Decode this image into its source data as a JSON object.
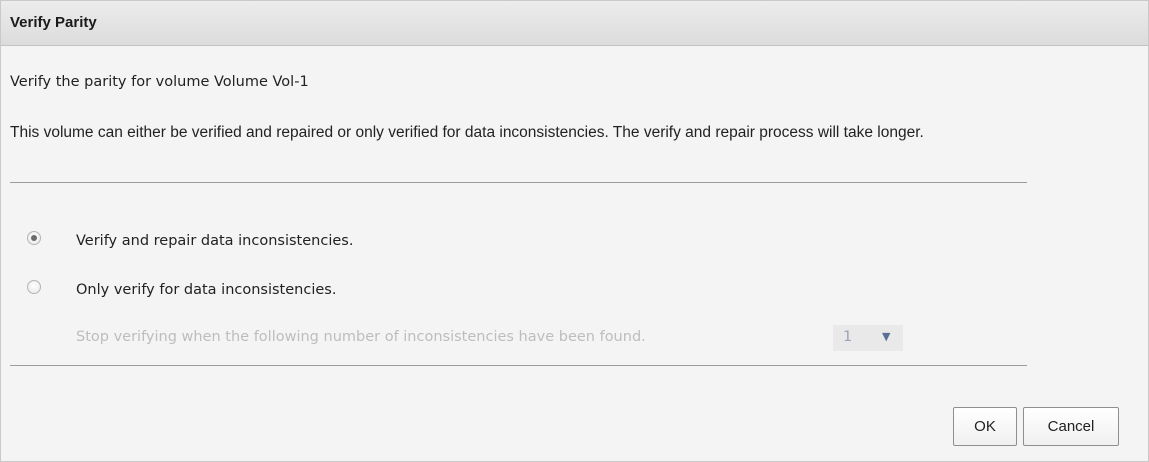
{
  "dialog": {
    "title": "Verify Parity",
    "heading": "Verify the parity for volume Volume Vol-1",
    "description": "This volume can either be verified and repaired or only verified for data inconsistencies. The verify and repair process will take longer.",
    "options": [
      {
        "label": "Verify and repair data inconsistencies.",
        "checked": true
      },
      {
        "label": "Only verify for data inconsistencies.",
        "checked": false
      }
    ],
    "stop_text": "Stop verifying when the following number of inconsistencies have been found.",
    "count_select": {
      "value": "1",
      "arrow_icon": "triangle-down-icon",
      "enabled": false
    },
    "buttons": {
      "ok": "OK",
      "cancel": "Cancel"
    }
  }
}
